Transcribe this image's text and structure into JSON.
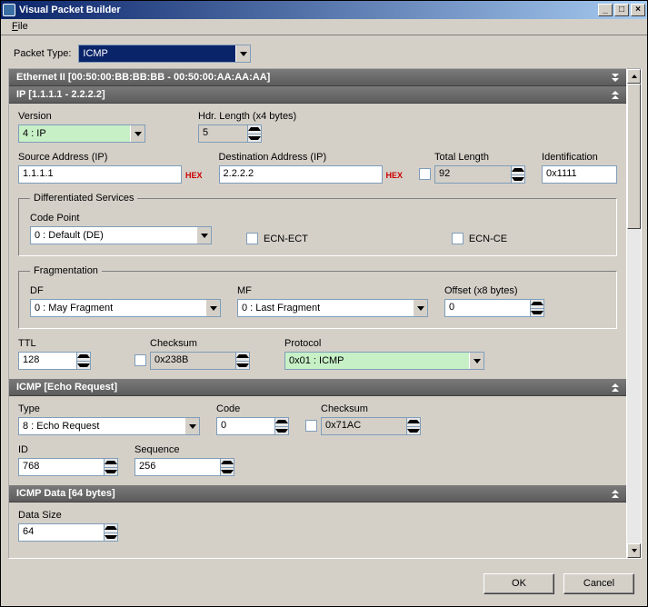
{
  "window": {
    "title": "Visual Packet Builder"
  },
  "menu": {
    "file": "File"
  },
  "packet_type": {
    "label": "Packet Type:",
    "value": "ICMP"
  },
  "sections": {
    "ethernet": {
      "title": "Ethernet II [00:50:00:BB:BB:BB - 00:50:00:AA:AA:AA]"
    },
    "ip": {
      "title": "IP [1.1.1.1 - 2.2.2.2]",
      "version": {
        "label": "Version",
        "value": "4 : IP"
      },
      "hdr_len": {
        "label": "Hdr. Length (x4 bytes)",
        "value": "5"
      },
      "src": {
        "label": "Source Address (IP)",
        "value": "1.1.1.1",
        "hex": "HEX"
      },
      "dst": {
        "label": "Destination Address (IP)",
        "value": "2.2.2.2",
        "hex": "HEX"
      },
      "total_len": {
        "label": "Total Length",
        "value": "92"
      },
      "ident": {
        "label": "Identification",
        "value": "0x1111"
      },
      "diffserv": {
        "legend": "Differentiated Services",
        "code_point": {
          "label": "Code Point",
          "value": "0 : Default (DE)"
        },
        "ecn_ect": "ECN-ECT",
        "ecn_ce": "ECN-CE"
      },
      "frag": {
        "legend": "Fragmentation",
        "df": {
          "label": "DF",
          "value": "0 : May Fragment"
        },
        "mf": {
          "label": "MF",
          "value": "0 : Last Fragment"
        },
        "offset": {
          "label": "Offset (x8 bytes)",
          "value": "0"
        }
      },
      "ttl": {
        "label": "TTL",
        "value": "128"
      },
      "checksum": {
        "label": "Checksum",
        "value": "0x238B"
      },
      "protocol": {
        "label": "Protocol",
        "value": "0x01 : ICMP"
      }
    },
    "icmp": {
      "title": "ICMP [Echo Request]",
      "type": {
        "label": "Type",
        "value": "8 : Echo Request"
      },
      "code": {
        "label": "Code",
        "value": "0"
      },
      "checksum": {
        "label": "Checksum",
        "value": "0x71AC"
      },
      "id": {
        "label": "ID",
        "value": "768"
      },
      "seq": {
        "label": "Sequence",
        "value": "256"
      }
    },
    "icmp_data": {
      "title": "ICMP Data [64 bytes]",
      "size": {
        "label": "Data Size",
        "value": "64"
      }
    }
  },
  "footer": {
    "ok": "OK",
    "cancel": "Cancel"
  }
}
